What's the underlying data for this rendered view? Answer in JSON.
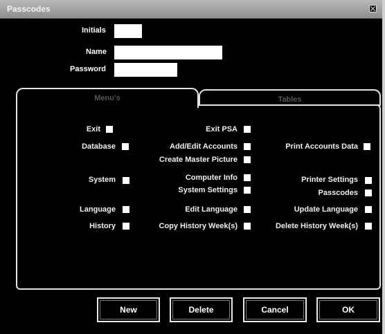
{
  "window": {
    "title": "Passcodes"
  },
  "fields": {
    "initials_label": "Initials",
    "name_label": "Name",
    "password_label": "Password",
    "initials_value": "",
    "name_value": "",
    "password_value": ""
  },
  "tabs": {
    "menus": "Menu's",
    "other": "Tables"
  },
  "options": {
    "exit": "Exit",
    "exit_psa": "Exit PSA",
    "database": "Database",
    "add_edit_accounts": "Add/Edit Accounts",
    "print_accounts_data": "Print Accounts Data",
    "create_master_picture": "Create Master Picture",
    "system": "System",
    "computer_info": "Computer Info",
    "system_settings": "System Settings",
    "printer_settings": "Printer Settings",
    "passcodes": "Passcodes",
    "language": "Language",
    "edit_language": "Edit Language",
    "update_language": "Update Language",
    "history": "History",
    "copy_history_weeks": "Copy History Week(s)",
    "delete_history_weeks": "Delete History Week(s)"
  },
  "buttons": {
    "new": "New",
    "delete": "Delete",
    "cancel": "Cancel",
    "ok": "OK"
  }
}
